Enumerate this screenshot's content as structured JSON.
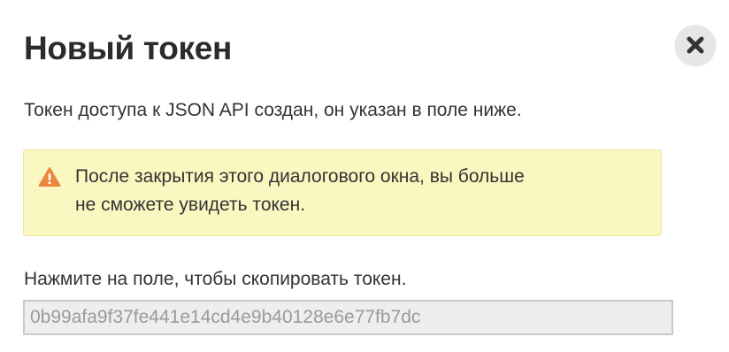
{
  "dialog": {
    "title": "Новый токен",
    "description": "Токен доступа к JSON API создан, он указан в поле ниже.",
    "warning": {
      "icon": "warning-icon",
      "line1": "После закрытия этого диалогового окна, вы больше",
      "line2": "не сможете увидеть токен."
    },
    "hint": "Нажмите на поле, чтобы скопировать токен.",
    "token_value": "0b99afa9f37fe441e14cd4e9b40128e6e77fb7dc",
    "close_icon": "close-icon"
  },
  "colors": {
    "warning_bg": "#fbf7c0",
    "warning_border": "#eee59a",
    "warning_icon": "#e8873d",
    "field_bg": "#eeeeee",
    "field_text": "#9a9a9a",
    "close_bg": "#e6e6e6"
  }
}
